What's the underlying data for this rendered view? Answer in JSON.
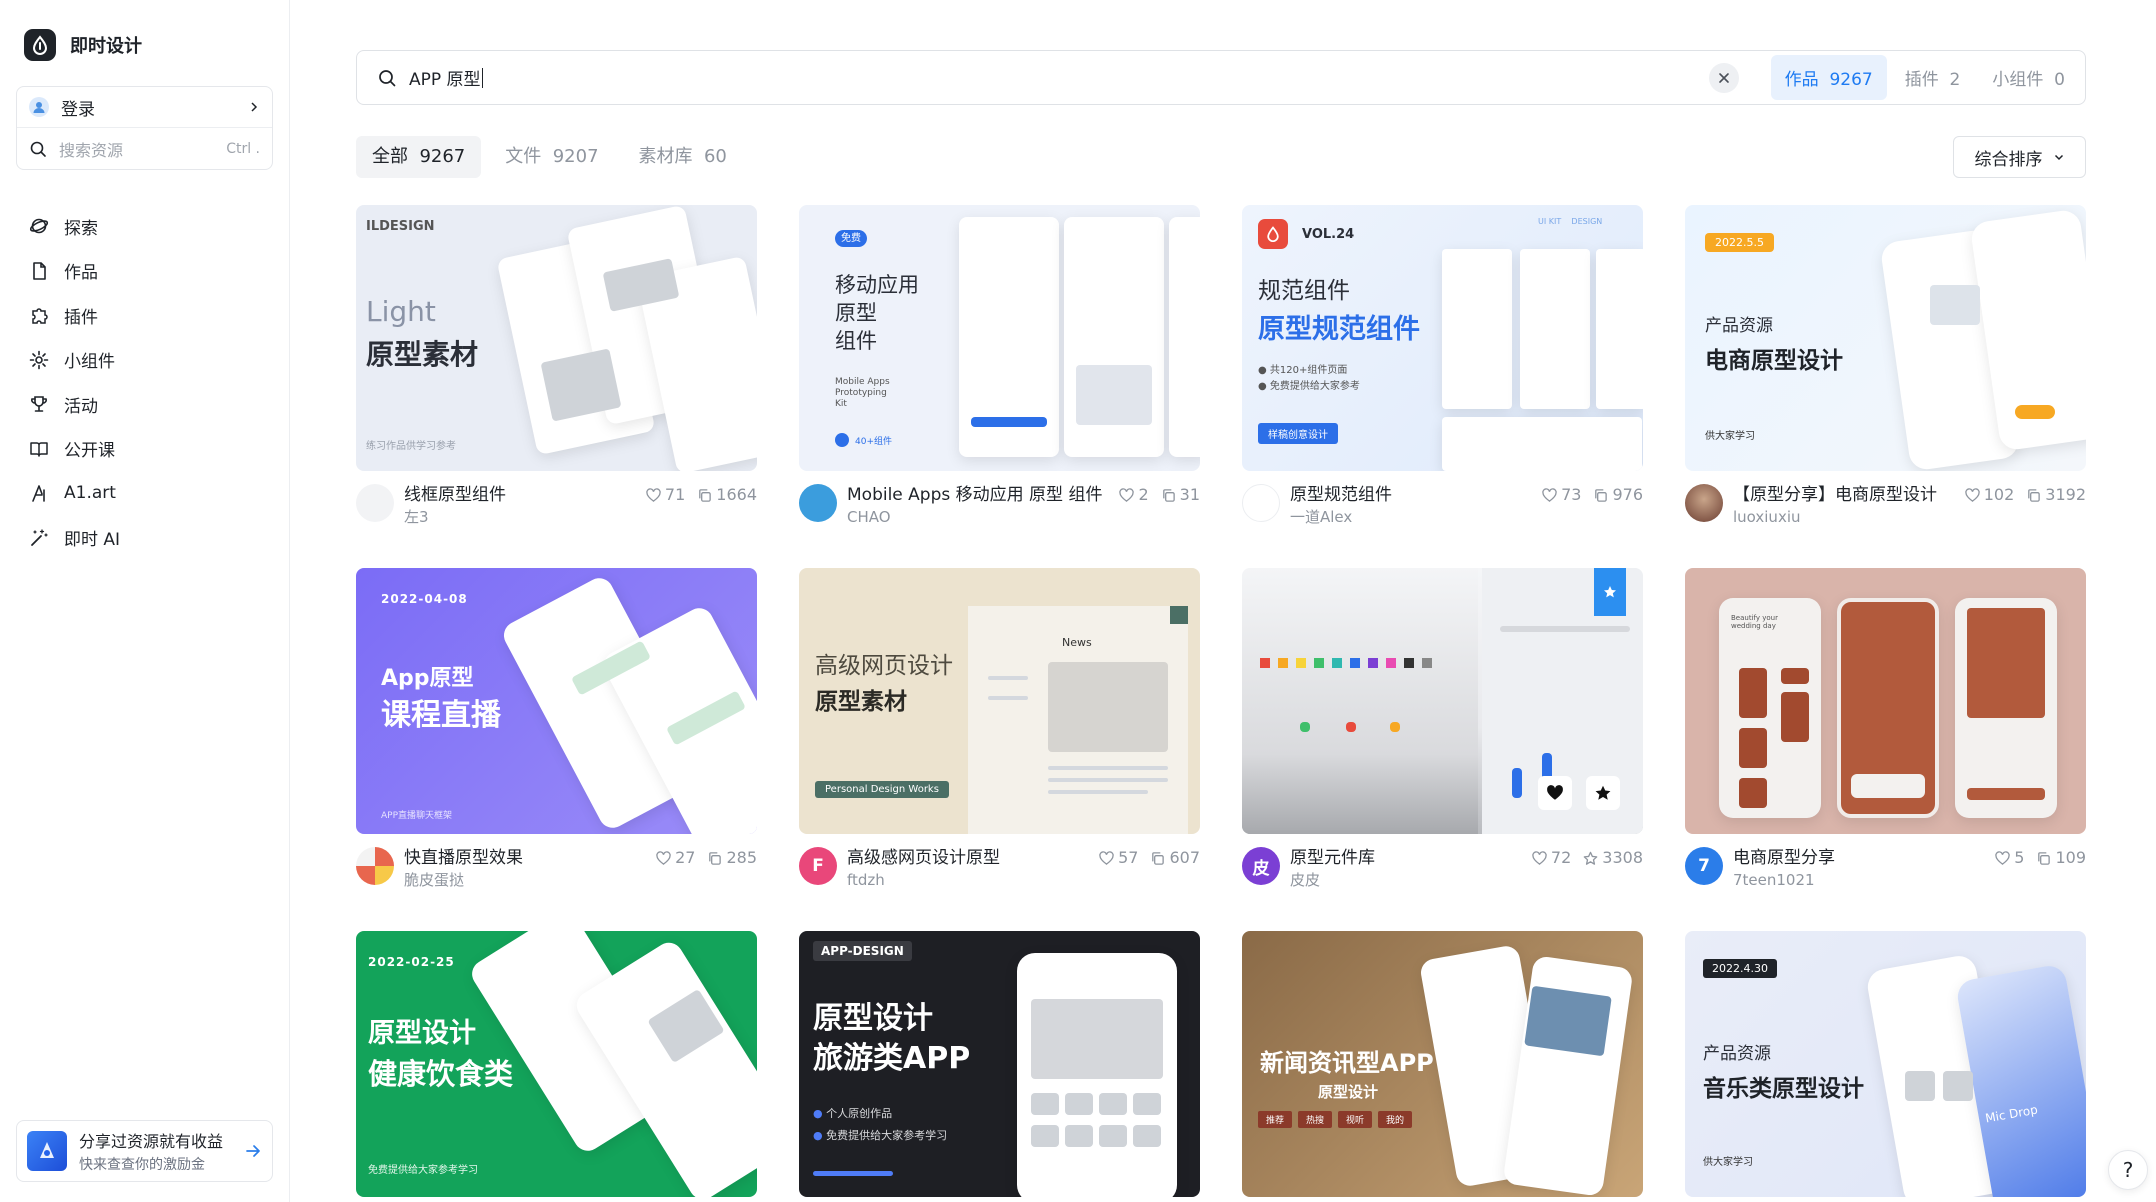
{
  "brand": {
    "name": "即时设计"
  },
  "sidebar": {
    "login_label": "登录",
    "search_placeholder": "搜索资源",
    "search_shortcut": "Ctrl .",
    "items": [
      {
        "label": "探索",
        "icon": "explore-icon"
      },
      {
        "label": "作品",
        "icon": "file-icon"
      },
      {
        "label": "插件",
        "icon": "plugin-icon"
      },
      {
        "label": "小组件",
        "icon": "widget-icon"
      },
      {
        "label": "活动",
        "icon": "trophy-icon"
      },
      {
        "label": "公开课",
        "icon": "book-icon"
      },
      {
        "label": "A1.art",
        "icon": "a1-art-icon"
      },
      {
        "label": "即时 AI",
        "icon": "magic-wand-icon"
      }
    ],
    "promo": {
      "title": "分享过资源就有收益",
      "subtitle": "快来查查你的激励金"
    }
  },
  "search": {
    "query": "APP 原型",
    "tabs": [
      {
        "label": "作品",
        "count": "9267",
        "active": true
      },
      {
        "label": "插件",
        "count": "2",
        "active": false
      },
      {
        "label": "小组件",
        "count": "0",
        "active": false
      }
    ]
  },
  "filters": [
    {
      "label": "全部",
      "count": "9267",
      "active": true
    },
    {
      "label": "文件",
      "count": "9207",
      "active": false
    },
    {
      "label": "素材库",
      "count": "60",
      "active": false
    }
  ],
  "sort": {
    "label": "综合排序"
  },
  "cards": [
    {
      "title": "线框原型组件",
      "author": "左3",
      "likes": "71",
      "copies": "1664",
      "stat2_icon": "duplicate-icon",
      "avatar": {
        "text": "",
        "color": "#f2f3f5"
      },
      "thumb": {
        "brand": "ILDESIGN",
        "line1": "Light",
        "line2": "原型素材",
        "footer": "练习作品供学习参考"
      }
    },
    {
      "title": "Mobile Apps 移动应用 原型 组件",
      "author": "CHAO",
      "likes": "2",
      "copies": "31",
      "stat2_icon": "duplicate-icon",
      "avatar": {
        "text": "",
        "color": "#3b9ddd"
      },
      "thumb": {
        "badge": "免费",
        "line1": "移动应用",
        "line2": "原型",
        "line3": "组件",
        "sub1": "Mobile Apps",
        "sub2": "Prototyping",
        "sub3": "Kit",
        "footer": "40+组件"
      }
    },
    {
      "title": "原型规范组件",
      "author": "一道Alex",
      "likes": "73",
      "copies": "976",
      "stat2_icon": "duplicate-icon",
      "avatar": {
        "text": "",
        "color": "#ffffff"
      },
      "thumb": {
        "vol": "VOL.24",
        "tag": "UI KIT    DESIGN",
        "line1": "规范组件",
        "line2": "原型规范组件",
        "b1": "共120+组件页面",
        "b2": "免费提供给大家参考",
        "button": "样稿创意设计"
      }
    },
    {
      "title": "【原型分享】电商原型设计",
      "author": "luoxiuxiu",
      "likes": "102",
      "copies": "3192",
      "stat2_icon": "duplicate-icon",
      "avatar": {
        "text": "",
        "color": "#8a4b3c"
      },
      "thumb": {
        "date": "2022.5.5",
        "line1": "产品资源",
        "line2": "电商原型设计",
        "footer": "供大家学习"
      }
    },
    {
      "title": "快直播原型效果",
      "author": "脆皮蛋挞",
      "likes": "27",
      "copies": "285",
      "stat2_icon": "duplicate-icon",
      "avatar": {
        "text": "",
        "color": "#e8664e"
      },
      "thumb": {
        "date": "2022-04-08",
        "line1": "App原型",
        "line2": "课程直播",
        "footer": "APP直播聊天框架"
      }
    },
    {
      "title": "高级感网页设计原型",
      "author": "ftdzh",
      "likes": "57",
      "copies": "607",
      "stat2_icon": "duplicate-icon",
      "avatar": {
        "text": "F",
        "color": "#e9477a"
      },
      "thumb": {
        "line1": "高级网页设计",
        "line2": "原型素材",
        "pill": "Personal Design Works",
        "news": "News"
      }
    },
    {
      "title": "原型元件库",
      "author": "皮皮",
      "likes": "72",
      "copies": "3308",
      "stat2_icon": "star-icon",
      "avatar": {
        "text": "皮",
        "color": "#7b3fd4"
      },
      "thumb": {}
    },
    {
      "title": "电商原型分享",
      "author": "7teen1021",
      "likes": "5",
      "copies": "109",
      "stat2_icon": "duplicate-icon",
      "avatar": {
        "text": "7",
        "color": "#2b7de9"
      },
      "thumb": {
        "title": "Beautify your wedding day"
      }
    },
    {
      "title": "",
      "author": "",
      "likes": "",
      "copies": "",
      "avatar": {
        "text": "",
        "color": "#ffffff"
      },
      "thumb": {
        "date": "2022-02-25",
        "line1": "原型设计",
        "line2": "健康饮食类",
        "footer": "免费提供给大家参考学习"
      }
    },
    {
      "title": "",
      "author": "",
      "likes": "",
      "copies": "",
      "avatar": {
        "text": "",
        "color": "#ffffff"
      },
      "thumb": {
        "badge": "APP-DESIGN",
        "line1": "原型设计",
        "line2": "旅游类APP",
        "b1": "个人原创作品",
        "b2": "免费提供给大家参考学习"
      }
    },
    {
      "title": "",
      "author": "",
      "likes": "",
      "copies": "",
      "avatar": {
        "text": "",
        "color": "#ffffff"
      },
      "thumb": {
        "line1": "新闻资讯型APP",
        "line2": "原型设计",
        "tags": [
          "推荐",
          "热搜",
          "视听",
          "我的"
        ]
      }
    },
    {
      "title": "",
      "author": "",
      "likes": "",
      "copies": "",
      "avatar": {
        "text": "",
        "color": "#ffffff"
      },
      "thumb": {
        "date": "2022.4.30",
        "line1": "产品资源",
        "line2": "音乐类原型设计",
        "footer": "供大家学习",
        "song": "Mic Drop"
      }
    }
  ],
  "help": {
    "label": "?"
  }
}
